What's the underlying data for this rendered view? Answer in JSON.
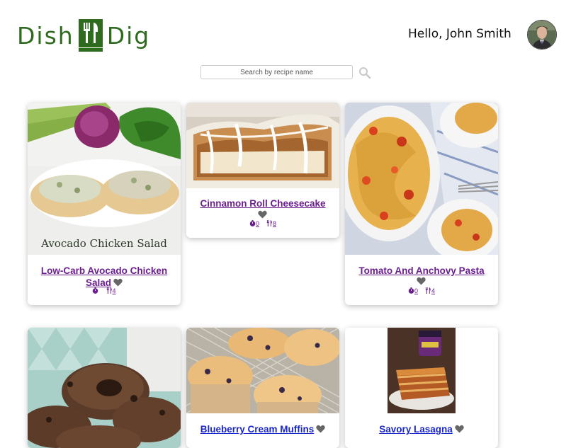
{
  "brand": {
    "name_left": "Dish",
    "name_right": "Dig",
    "color": "#2f6b1f"
  },
  "header": {
    "greeting": "Hello, John Smith"
  },
  "search": {
    "placeholder": "Search by recipe name"
  },
  "recipes": [
    {
      "title": "Low-Carb Avocado Chicken Salad",
      "image_caption": "Avocado Chicken Salad",
      "time": "",
      "servings": "4",
      "favorite_icon": "heart-icon"
    },
    {
      "title": "Cinnamon Roll Cheesecake",
      "time": "0",
      "servings": "8",
      "favorite_icon": "heart-icon"
    },
    {
      "title": "Tomato And Anchovy Pasta",
      "time": "0",
      "servings": "4",
      "favorite_icon": "heart-icon"
    },
    {
      "title": "",
      "favorite_icon": "heart-icon"
    },
    {
      "title": "Blueberry Cream Muffins",
      "favorite_icon": "heart-icon"
    },
    {
      "title": "Savory Lasagna",
      "favorite_icon": "heart-icon"
    }
  ],
  "colors": {
    "link_visited": "#6b1f8f",
    "link": "#1a26c7",
    "heart": "#666666"
  }
}
